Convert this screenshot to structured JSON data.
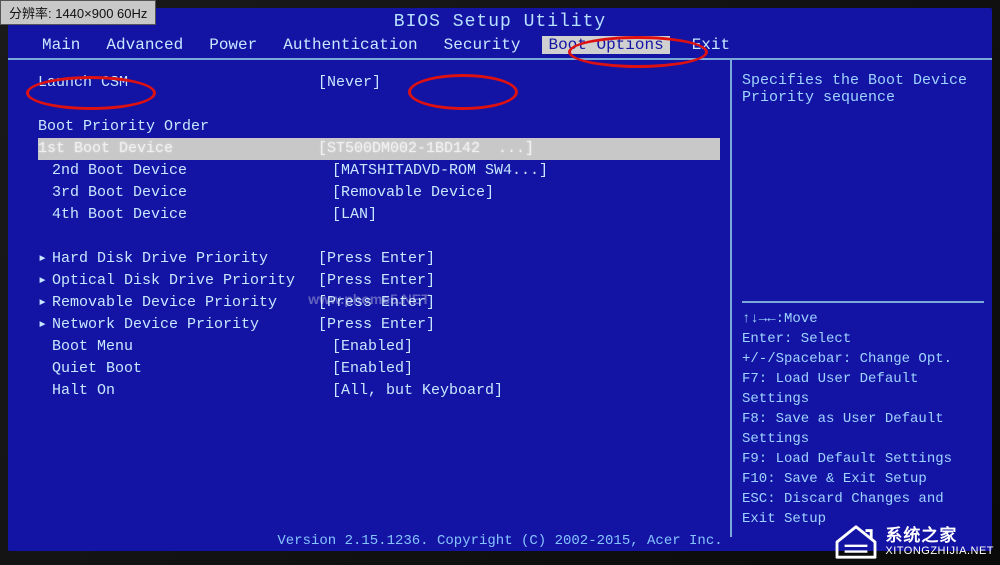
{
  "osd": {
    "text": "分辨率:  1440×900 60Hz"
  },
  "title": "BIOS Setup Utility",
  "menu": {
    "items": [
      "Main",
      "Advanced",
      "Power",
      "Authentication",
      "Security",
      "Boot Options",
      "Exit"
    ],
    "active_index": 5
  },
  "options": {
    "launch_csm": {
      "label": "Launch CSM",
      "value": "[Never]"
    },
    "boot_order_header": "Boot Priority Order",
    "boot1": {
      "label": "1st Boot Device",
      "value": "[ST500DM002-1BD142  ...]"
    },
    "boot2": {
      "label": "2nd Boot Device",
      "value": "[MATSHITADVD-ROM SW4...]"
    },
    "boot3": {
      "label": "3rd Boot Device",
      "value": "[Removable Device]"
    },
    "boot4": {
      "label": "4th Boot Device",
      "value": "[LAN]"
    },
    "hdd_prio": {
      "label": "Hard Disk Drive Priority",
      "value": "[Press Enter]"
    },
    "opt_prio": {
      "label": "Optical Disk Drive Priority",
      "value": "[Press Enter]"
    },
    "rem_prio": {
      "label": "Removable Device Priority",
      "value": "[Press Enter]"
    },
    "net_prio": {
      "label": "Network Device Priority",
      "value": "[Press Enter]"
    },
    "boot_menu": {
      "label": "Boot Menu",
      "value": "[Enabled]"
    },
    "quiet_boot": {
      "label": "Quiet Boot",
      "value": "[Enabled]"
    },
    "halt_on": {
      "label": "Halt On",
      "value": "[All, but Keyboard]"
    }
  },
  "side": {
    "desc_line1": "Specifies the Boot Device",
    "desc_line2": "Priority sequence",
    "help": [
      "↑↓→←:Move",
      "Enter: Select",
      "+/-/Spacebar: Change Opt.",
      "F7: Load User Default Settings",
      "F8: Save as User Default Settings",
      "F9: Load Default Settings",
      "F10: Save & Exit Setup",
      "ESC: Discard Changes and Exit Setup"
    ]
  },
  "footer": "Version 2.15.1236. Copyright (C) 2002-2015, Acer Inc.",
  "center_watermark": "www.phome5.NET",
  "logo": {
    "cn": "系统之家",
    "en": "XITONGZHIJIA.NET"
  }
}
